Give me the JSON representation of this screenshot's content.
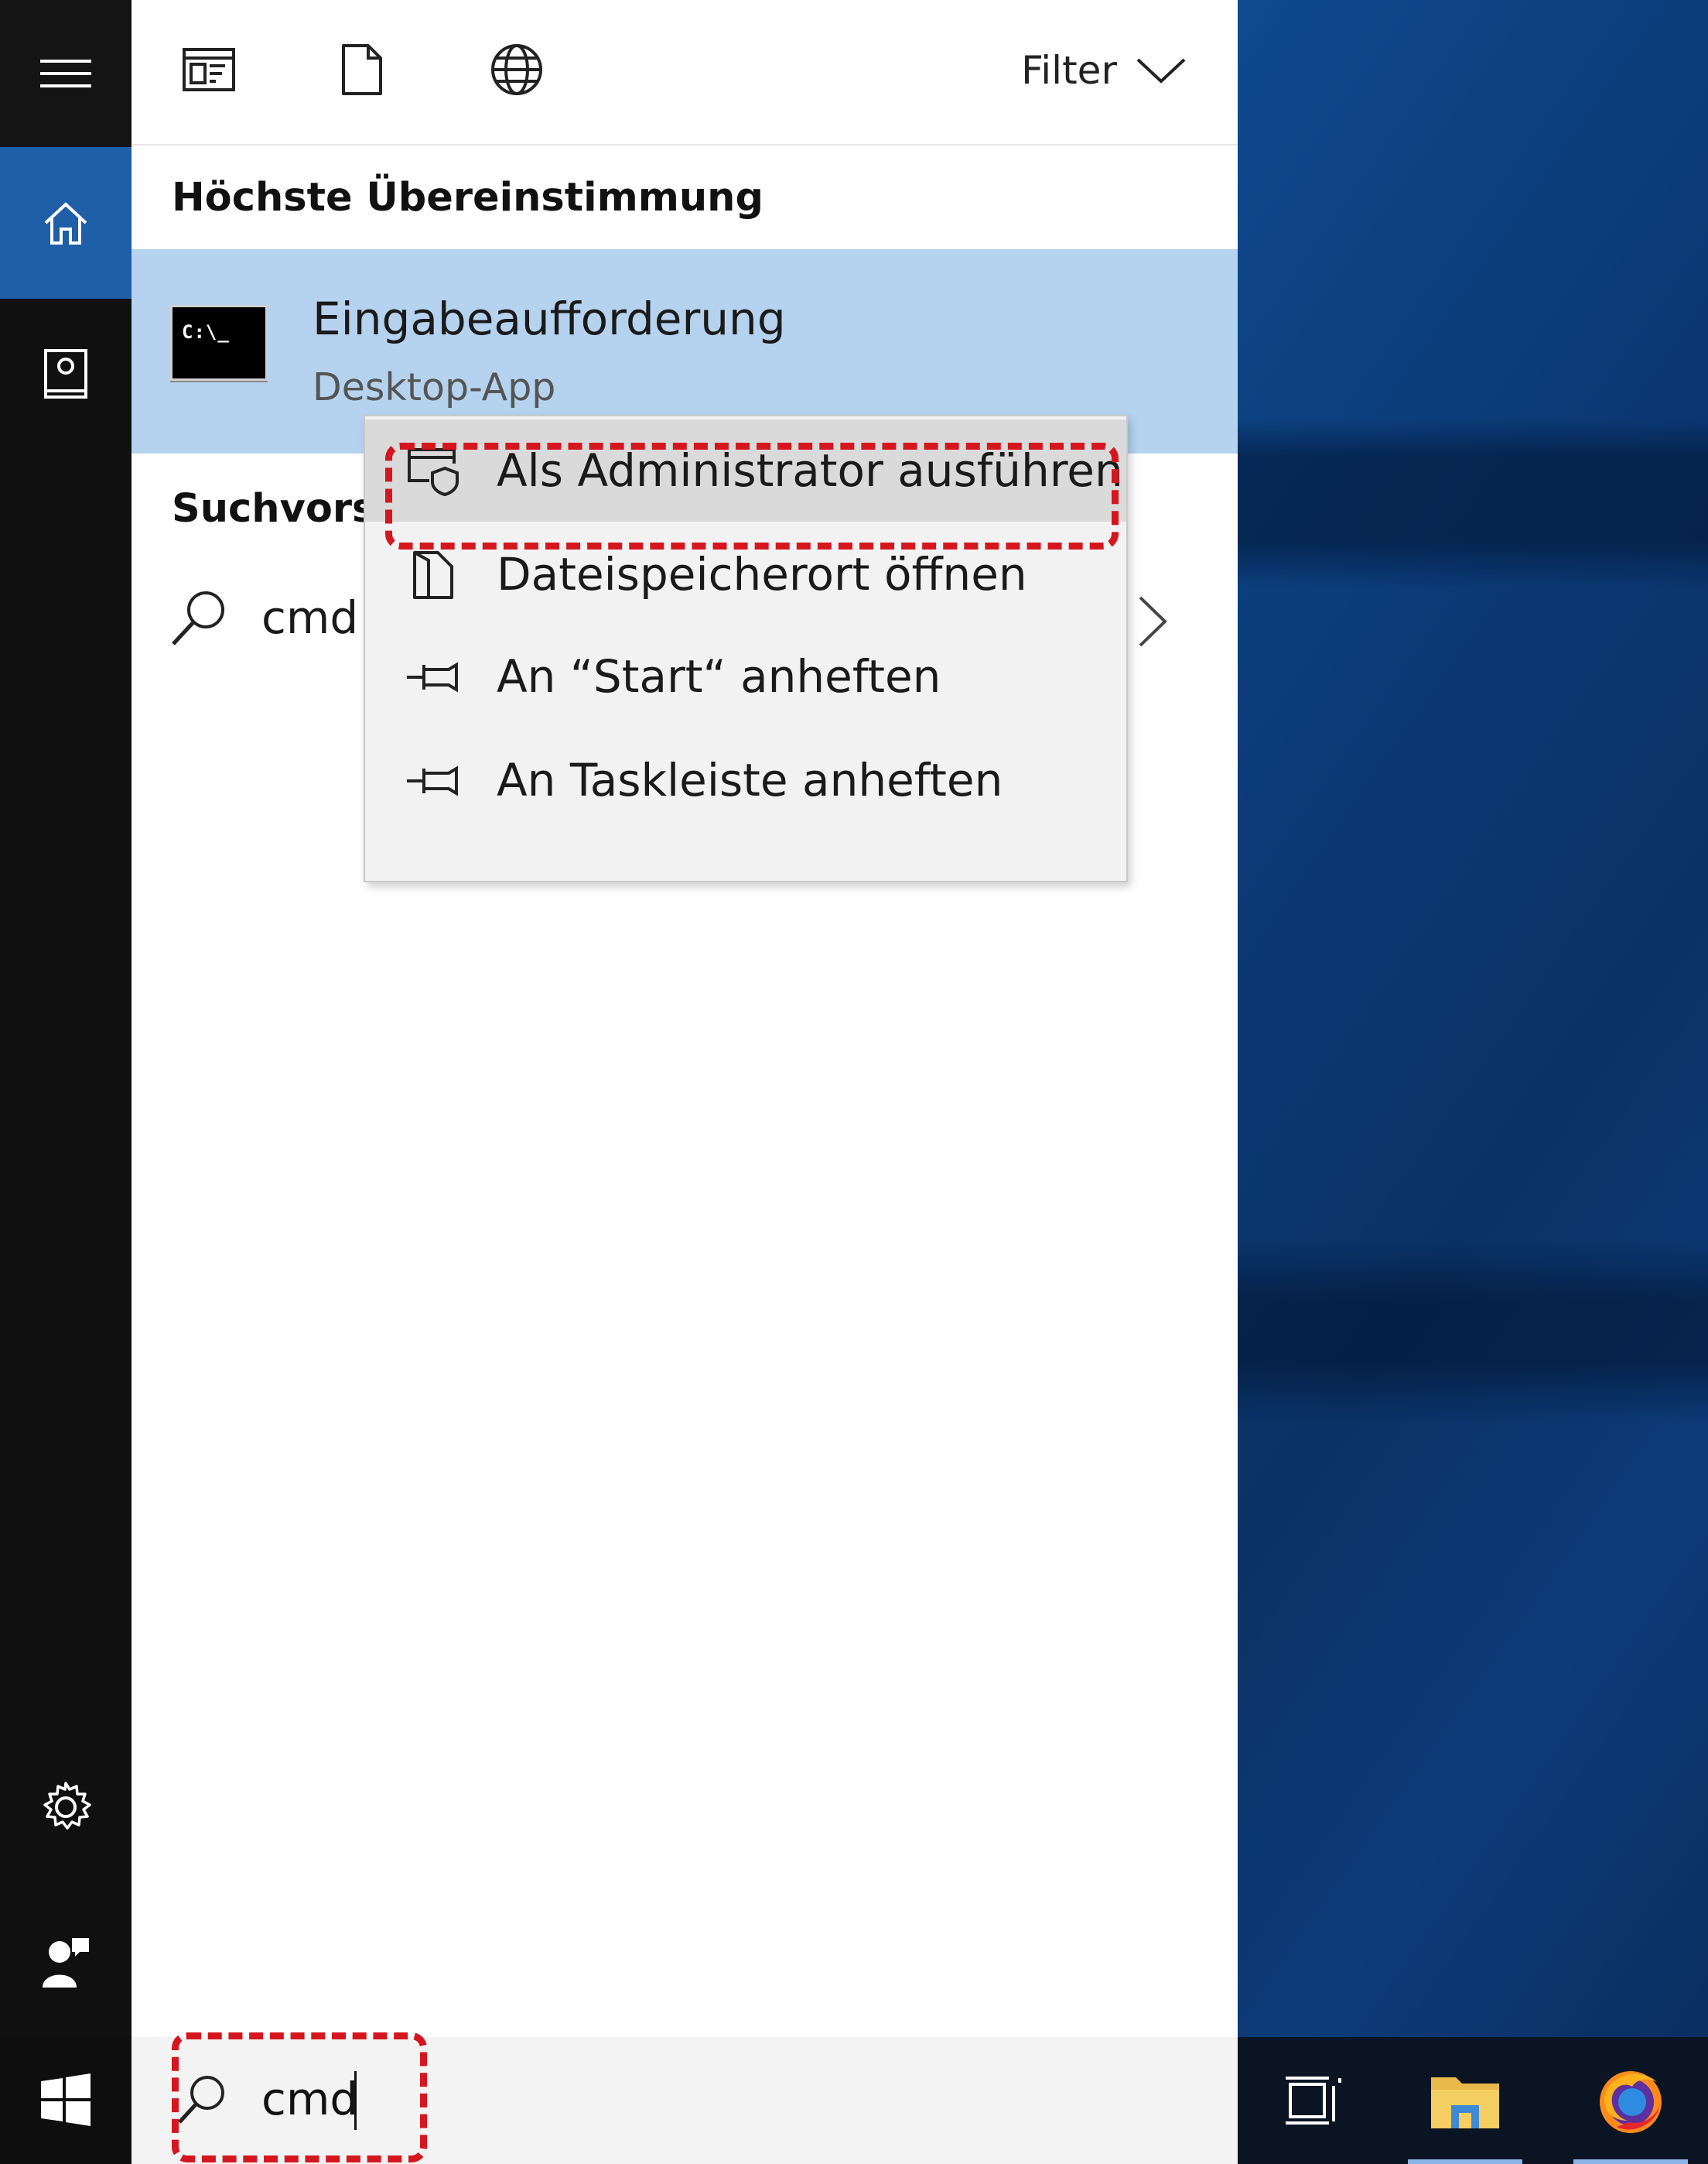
{
  "toolbar": {
    "apps_icon": "apps-filter-icon",
    "documents_icon": "document-icon",
    "web_icon": "globe-icon",
    "filter_label": "Filter"
  },
  "best_match": {
    "heading": "Höchste Übereinstimmung",
    "title": "Eingabeaufforderung",
    "subtitle": "Desktop-App",
    "icon_prompt": "C:\\_"
  },
  "suggestions": {
    "heading": "Suchvorsc",
    "item_text": "cmd"
  },
  "context_menu": {
    "items": [
      {
        "label": "Als Administrator ausführen",
        "icon": "shield-window-icon"
      },
      {
        "label": "Dateispeicherort öffnen",
        "icon": "file-location-icon"
      },
      {
        "label": "An “Start“ anheften",
        "icon": "pin-icon"
      },
      {
        "label": "An Taskleiste anheften",
        "icon": "pin-icon"
      }
    ]
  },
  "search": {
    "value": "cmd"
  },
  "colors": {
    "accent": "#1f5fa8",
    "selection": "#b5d3ef",
    "highlight": "#d5161e",
    "rail": "#101010"
  }
}
